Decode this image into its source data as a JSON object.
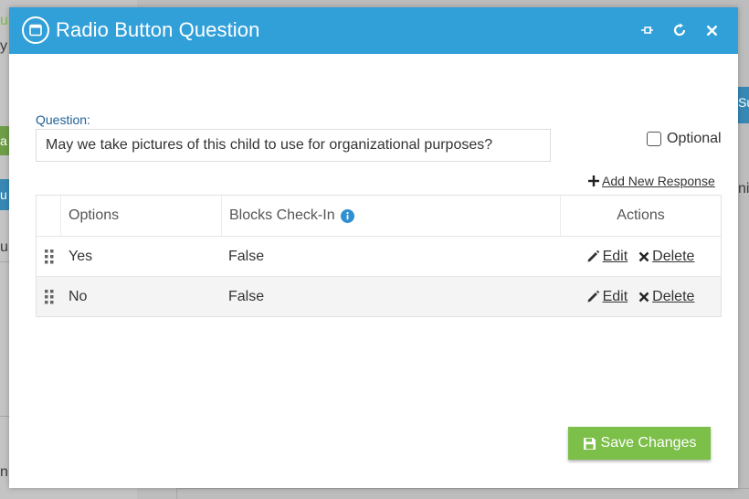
{
  "background": {
    "left_fragments": [
      "u",
      "y",
      "a",
      "u",
      "ur",
      "n"
    ],
    "right_fragments": [
      "Su",
      "ni"
    ]
  },
  "modal": {
    "title": "Radio Button Question",
    "header_icons": [
      "window-icon",
      "pin-icon",
      "refresh-icon",
      "close-icon"
    ],
    "question_label": "Question:",
    "question_value": "May we take pictures of this child to use for organizational purposes?",
    "optional_label": "Optional",
    "optional_checked": false,
    "add_response_label": "Add New Response",
    "table": {
      "headers": [
        "Options",
        "Blocks Check-In",
        "Actions"
      ],
      "rows": [
        {
          "option": "Yes",
          "blocks": "False"
        },
        {
          "option": "No",
          "blocks": "False"
        }
      ],
      "edit_label": "Edit",
      "delete_label": "Delete"
    },
    "save_label": "Save Changes"
  },
  "colors": {
    "header": "#32a0d8",
    "save_button": "#7cbf49",
    "label_blue": "#1f5f95",
    "info_icon": "#2f8fd0"
  }
}
